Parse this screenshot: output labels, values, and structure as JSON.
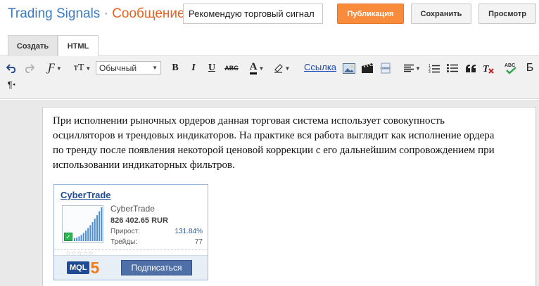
{
  "header": {
    "blog_name": "Trading Signals",
    "separator": "·",
    "section": "Сообщение",
    "title_input_value": "Рекомендую торговый сигнал",
    "publish_label": "Публикация",
    "save_label": "Сохранить",
    "preview_label": "Просмотр"
  },
  "tabs": [
    {
      "label": "Создать",
      "active": true
    },
    {
      "label": "HTML",
      "active": false
    }
  ],
  "toolbar": {
    "font_label": "Ƒ",
    "font_size_label": "тT",
    "format_value": "Обычный",
    "bold_label": "B",
    "italic_label": "I",
    "underline_label": "U",
    "strike_label": "ABC",
    "text_color_label": "A",
    "link_label": "Ссылка",
    "spellcheck_label": "ABC",
    "language_label": "Б",
    "rtl_label": "¶",
    "icons": [
      "undo-icon",
      "redo-icon",
      "font-icon",
      "font-size-icon",
      "bold-icon",
      "italic-icon",
      "underline-icon",
      "strikethrough-icon",
      "text-color-icon",
      "highlight-icon",
      "image-icon",
      "video-icon",
      "jump-break-icon",
      "align-icon",
      "numbered-list-icon",
      "bulleted-list-icon",
      "quote-icon",
      "clear-format-icon",
      "spellcheck-icon",
      "language-icon",
      "rtl-icon"
    ]
  },
  "content": {
    "paragraph": "При исполнении рыночных ордеров данная торговая система использует совокупность осцилляторов и трендовых индикаторов. На практике вся работа выглядит как исполнение ордера по тренду после появления некоторой ценовой коррекции с его дальнейшим сопровождением при использовании индикаторных фильтров."
  },
  "widget": {
    "name": "CyberTrade",
    "subname": "CyberTrade",
    "balance": "826 402.65 RUR",
    "growth_label": "Прирост:",
    "growth_value": "131.84%",
    "trades_label": "Трейды:",
    "trades_value": "77",
    "rating_stars": 0,
    "logo_text": "MQL",
    "logo_number": "5",
    "subscribe_label": "Подписаться",
    "accent_color": "#1f4b95",
    "chart_bar_color": "#4a8fd6"
  }
}
